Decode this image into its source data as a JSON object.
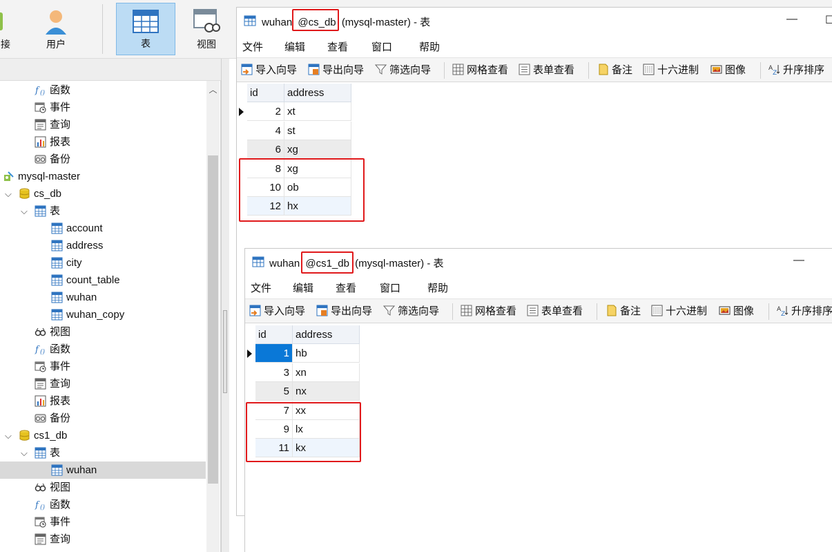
{
  "main_toolbar": {
    "buttons": [
      {
        "label": "接",
        "icon": "connection-icon"
      },
      {
        "label": "用户",
        "icon": "user-icon"
      },
      {
        "label": "表",
        "icon": "table-icon"
      },
      {
        "label": "视图",
        "icon": "view-icon"
      }
    ]
  },
  "tree": [
    {
      "label": "函数",
      "icon": "function-icon"
    },
    {
      "label": "事件",
      "icon": "event-icon"
    },
    {
      "label": "查询",
      "icon": "query-icon"
    },
    {
      "label": "报表",
      "icon": "report-icon"
    },
    {
      "label": "备份",
      "icon": "backup-icon"
    },
    {
      "label": "mysql-master",
      "icon": "connection-icon"
    },
    {
      "label": "cs_db",
      "icon": "database-icon"
    },
    {
      "label": "表",
      "icon": "tables-icon"
    },
    {
      "label": "account",
      "icon": "table-icon"
    },
    {
      "label": "address",
      "icon": "table-icon"
    },
    {
      "label": "city",
      "icon": "table-icon"
    },
    {
      "label": "count_table",
      "icon": "table-icon"
    },
    {
      "label": "wuhan",
      "icon": "table-icon"
    },
    {
      "label": "wuhan_copy",
      "icon": "table-icon"
    },
    {
      "label": "视图",
      "icon": "view-icon"
    },
    {
      "label": "函数",
      "icon": "function-icon"
    },
    {
      "label": "事件",
      "icon": "event-icon"
    },
    {
      "label": "查询",
      "icon": "query-icon"
    },
    {
      "label": "报表",
      "icon": "report-icon"
    },
    {
      "label": "备份",
      "icon": "backup-icon"
    },
    {
      "label": "cs1_db",
      "icon": "database-icon"
    },
    {
      "label": "表",
      "icon": "tables-icon"
    },
    {
      "label": "wuhan",
      "icon": "table-icon"
    },
    {
      "label": "视图",
      "icon": "view-icon"
    },
    {
      "label": "函数",
      "icon": "function-icon"
    },
    {
      "label": "事件",
      "icon": "event-icon"
    },
    {
      "label": "查询",
      "icon": "query-icon"
    }
  ],
  "window1": {
    "title_prefix": "wuhan",
    "title_db": "@cs_db",
    "title_suffix": "(mysql-master) - 表",
    "minimize": "—",
    "maximize": "☐"
  },
  "window2": {
    "title_prefix": "wuhan",
    "title_db": "@cs1_db",
    "title_suffix": "(mysql-master) - 表",
    "minimize": "—"
  },
  "menu": [
    "文件",
    "编辑",
    "查看",
    "窗口",
    "帮助"
  ],
  "tools": [
    {
      "label": "导入向导",
      "icon": "import-wizard-icon"
    },
    {
      "label": "导出向导",
      "icon": "export-wizard-icon"
    },
    {
      "label": "筛选向导",
      "icon": "filter-wizard-icon"
    },
    {
      "label": "网格查看",
      "icon": "grid-view-icon"
    },
    {
      "label": "表单查看",
      "icon": "form-view-icon"
    },
    {
      "label": "备注",
      "icon": "memo-icon"
    },
    {
      "label": "十六进制",
      "icon": "hex-icon"
    },
    {
      "label": "图像",
      "icon": "image-icon"
    },
    {
      "label": "升序排序",
      "icon": "sort-ascending-icon"
    }
  ],
  "columns": [
    "id",
    "address"
  ],
  "table1_rows": [
    {
      "id": "2",
      "address": "xt"
    },
    {
      "id": "4",
      "address": "st"
    },
    {
      "id": "6",
      "address": "xg"
    },
    {
      "id": "8",
      "address": "xg"
    },
    {
      "id": "10",
      "address": "ob"
    },
    {
      "id": "12",
      "address": "hx"
    }
  ],
  "table2_rows": [
    {
      "id": "1",
      "address": "hb"
    },
    {
      "id": "3",
      "address": "xn"
    },
    {
      "id": "5",
      "address": "nx"
    },
    {
      "id": "7",
      "address": "xx"
    },
    {
      "id": "9",
      "address": "lx"
    },
    {
      "id": "11",
      "address": "kx"
    }
  ],
  "colors": {
    "highlight_red": "#e0191b",
    "selected_cell": "#0a78d7",
    "active_button": "#bcdcf4",
    "table_icon_blue": "#2f74c0",
    "database_icon_yellow": "#e6c21f"
  }
}
